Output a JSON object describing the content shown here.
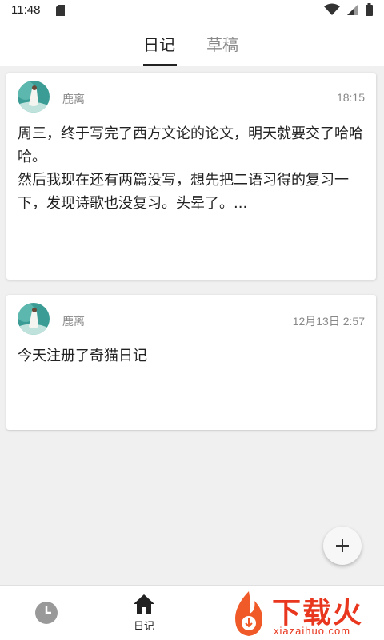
{
  "status_bar": {
    "time": "11:48",
    "icons": [
      "sd-card-icon",
      "wifi-icon",
      "signal-icon",
      "battery-icon"
    ]
  },
  "tabs": [
    {
      "label": "日记",
      "active": true
    },
    {
      "label": "草稿",
      "active": false
    }
  ],
  "entries": [
    {
      "author": "鹿离",
      "time": "18:15",
      "content": "周三，终于写完了西方文论的论文，明天就要交了哈哈哈。\n然后我现在还有两篇没写，想先把二语习得的复习一下，发现诗歌也没复习。头晕了。..."
    },
    {
      "author": "鹿离",
      "time": "12月13日 2:57",
      "content": "今天注册了奇猫日记"
    }
  ],
  "fab": {
    "icon": "plus-icon"
  },
  "bottom_nav": {
    "items": [
      {
        "icon": "clock-icon",
        "label": ""
      },
      {
        "icon": "home-icon",
        "label": "日记"
      }
    ]
  },
  "watermark": {
    "text": "下载火",
    "sub": "xiazaihuo.com"
  },
  "colors": {
    "accent": "#222222",
    "muted": "#888888",
    "background": "#f0f0f0",
    "watermark": "#e8371e"
  }
}
